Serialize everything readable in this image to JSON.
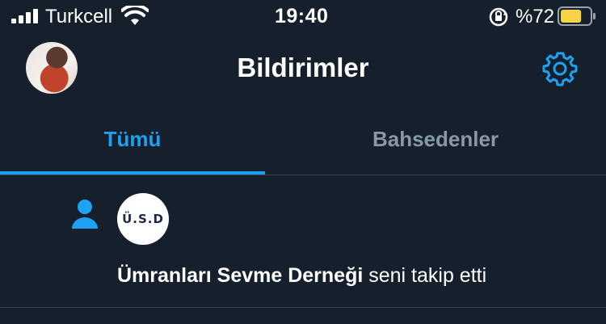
{
  "status_bar": {
    "carrier": "Turkcell",
    "time": "19:40",
    "battery_percent": "%72",
    "battery_level": 0.72
  },
  "header": {
    "title": "Bildirimler"
  },
  "tabs": [
    {
      "label": "Tümü",
      "active": true
    },
    {
      "label": "Bahsedenler",
      "active": false
    }
  ],
  "notifications": [
    {
      "avatar_text": "Ü.S.D",
      "actor": "Ümranları Sevme Derneği",
      "action": " seni takip etti"
    }
  ],
  "colors": {
    "background": "#16202c",
    "accent": "#1da1f2",
    "inactive_tab": "#8899a6",
    "divider": "#38444d",
    "battery_fill": "#f5d547"
  }
}
